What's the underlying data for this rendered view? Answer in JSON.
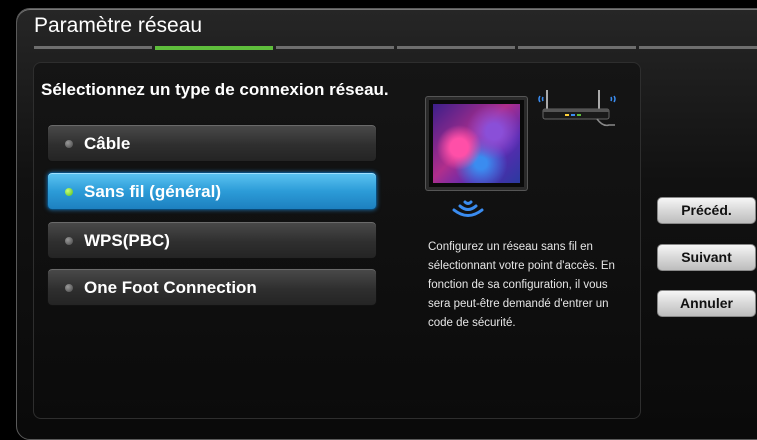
{
  "window": {
    "title": "Paramètre réseau"
  },
  "progress": {
    "total_steps": 6,
    "current_step": 2
  },
  "prompt": "Sélectionnez un type de connexion réseau.",
  "options": [
    {
      "label": "Câble",
      "selected": false
    },
    {
      "label": "Sans fil (général)",
      "selected": true
    },
    {
      "label": "WPS(PBC)",
      "selected": false
    },
    {
      "label": "One Foot Connection",
      "selected": false
    }
  ],
  "description": "Configurez un réseau sans fil en sélectionnant votre point d'accès. En fonction de sa configuration, il vous sera peut-être demandé d'entrer un code de sécurité.",
  "buttons": {
    "previous": "Précéd.",
    "next": "Suivant",
    "cancel": "Annuler"
  },
  "colors": {
    "progress_active": "#5fbe3c",
    "selected_option": "#2c9cd8",
    "wifi_waves": "#3a8cf0"
  },
  "icons": {
    "tv": "tv-icon",
    "wifi": "wifi-signal-icon",
    "router": "wireless-router-icon"
  }
}
